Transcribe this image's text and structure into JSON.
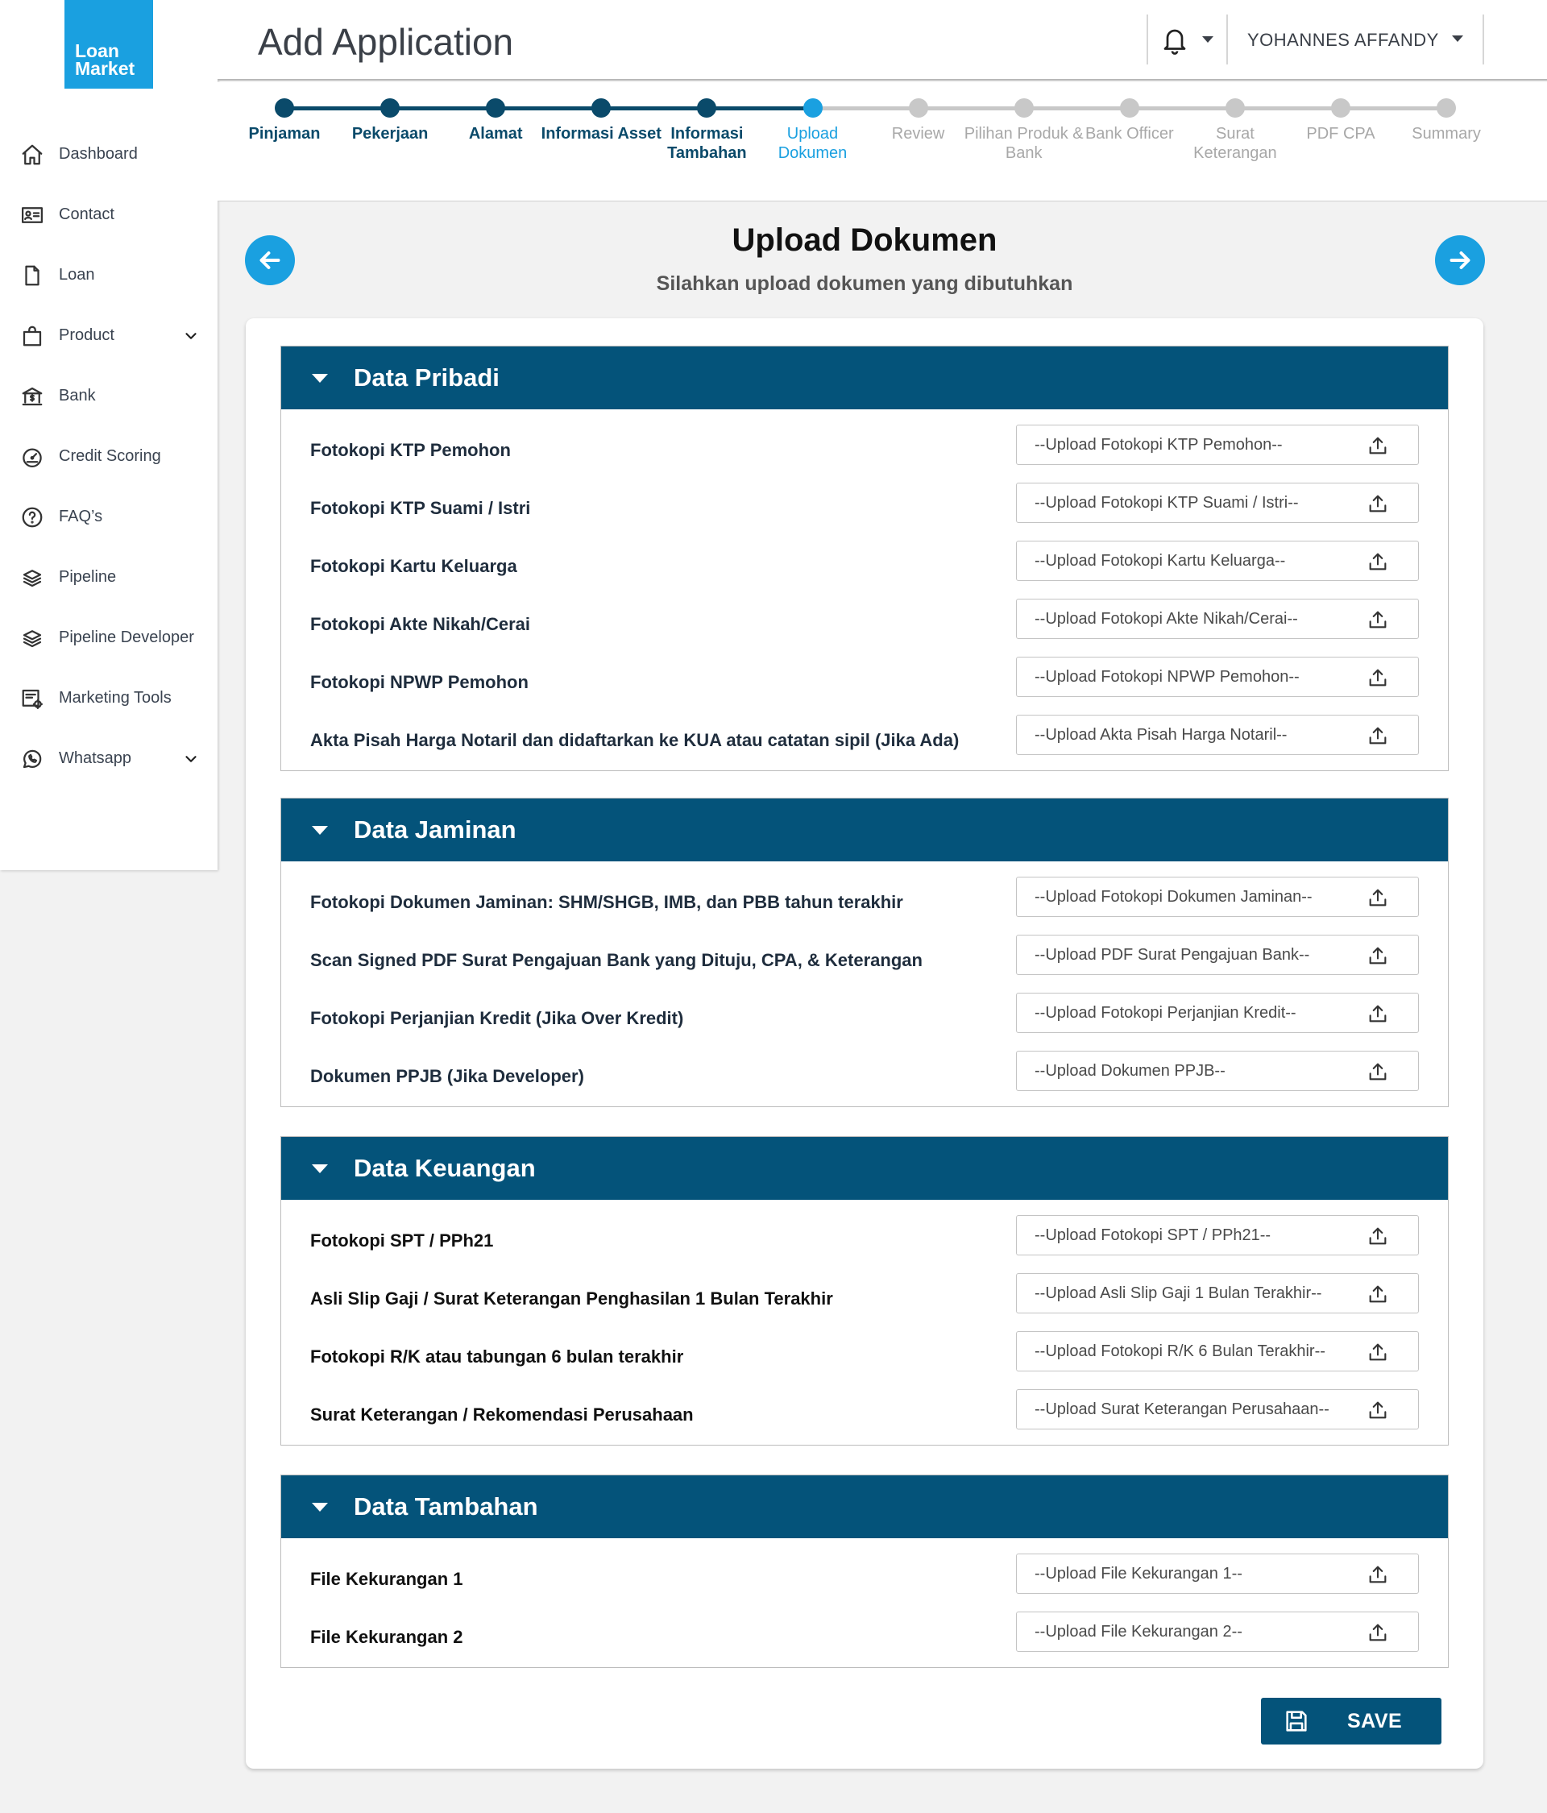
{
  "logo": {
    "line1": "Loan",
    "line2": "Market"
  },
  "sidebar": {
    "items": [
      {
        "label": "Dashboard",
        "icon": "home-icon"
      },
      {
        "label": "Contact",
        "icon": "contact-card-icon"
      },
      {
        "label": "Loan",
        "icon": "document-icon"
      },
      {
        "label": "Product",
        "icon": "shopping-bag-icon",
        "expandable": true
      },
      {
        "label": "Bank",
        "icon": "bank-icon"
      },
      {
        "label": "Credit Scoring",
        "icon": "gauge-icon"
      },
      {
        "label": "FAQ’s",
        "icon": "question-circle-icon"
      },
      {
        "label": "Pipeline",
        "icon": "layers-icon"
      },
      {
        "label": "Pipeline Developer",
        "icon": "layers-icon"
      },
      {
        "label": "Marketing Tools",
        "icon": "marketing-tools-icon"
      },
      {
        "label": "Whatsapp",
        "icon": "whatsapp-icon",
        "expandable": true
      }
    ]
  },
  "header": {
    "title": "Add Application",
    "user_name": "YOHANNES AFFANDY"
  },
  "stepper": {
    "steps": [
      {
        "label": "Pinjaman",
        "state": "done"
      },
      {
        "label": "Pekerjaan",
        "state": "done"
      },
      {
        "label": "Alamat",
        "state": "done"
      },
      {
        "label": "Informasi Asset",
        "state": "done"
      },
      {
        "label": "Informasi Tambahan",
        "state": "done"
      },
      {
        "label": "Upload Dokumen",
        "state": "active"
      },
      {
        "label": "Review",
        "state": "pending"
      },
      {
        "label": "Pilihan Produk & Bank",
        "state": "pending"
      },
      {
        "label": "Bank Officer",
        "state": "pending"
      },
      {
        "label": "Surat Keterangan",
        "state": "pending"
      },
      {
        "label": "PDF CPA",
        "state": "pending"
      },
      {
        "label": "Summary",
        "state": "pending"
      }
    ]
  },
  "main": {
    "title": "Upload Dokumen",
    "subtitle": "Silahkan upload dokumen yang dibutuhkan",
    "groups": [
      {
        "title": "Data Pribadi",
        "rows": [
          {
            "label": "Fotokopi KTP Pemohon",
            "placeholder": "--Upload Fotokopi KTP Pemohon--"
          },
          {
            "label": "Fotokopi KTP Suami / Istri",
            "placeholder": "--Upload Fotokopi KTP Suami / Istri--"
          },
          {
            "label": "Fotokopi Kartu Keluarga",
            "placeholder": "--Upload Fotokopi Kartu Keluarga--"
          },
          {
            "label": "Fotokopi Akte Nikah/Cerai",
            "placeholder": "--Upload Fotokopi Akte Nikah/Cerai--"
          },
          {
            "label": "Fotokopi NPWP Pemohon",
            "placeholder": "--Upload Fotokopi NPWP Pemohon--"
          },
          {
            "label": "Akta Pisah Harga Notaril dan didaftarkan ke KUA atau catatan sipil (Jika Ada)",
            "placeholder": "--Upload Akta Pisah Harga Notaril--"
          }
        ]
      },
      {
        "title": "Data Jaminan",
        "rows": [
          {
            "label": "Fotokopi Dokumen Jaminan: SHM/SHGB, IMB, dan PBB tahun terakhir",
            "placeholder": "--Upload Fotokopi Dokumen Jaminan--"
          },
          {
            "label": "Scan Signed PDF Surat Pengajuan Bank yang Dituju, CPA, & Keterangan",
            "placeholder": "--Upload PDF Surat Pengajuan Bank--"
          },
          {
            "label": "Fotokopi Perjanjian Kredit (Jika Over Kredit)",
            "placeholder": "--Upload Fotokopi Perjanjian Kredit--"
          },
          {
            "label": "Dokumen PPJB (Jika Developer)",
            "placeholder": "--Upload Dokumen PPJB--"
          }
        ]
      },
      {
        "title": "Data Keuangan",
        "rows": [
          {
            "label": "Fotokopi SPT / PPh21",
            "placeholder": "--Upload Fotokopi SPT / PPh21--"
          },
          {
            "label": "Asli Slip Gaji / Surat Keterangan Penghasilan 1 Bulan Terakhir",
            "placeholder": "--Upload Asli Slip Gaji 1 Bulan Terakhir--"
          },
          {
            "label": "Fotokopi R/K atau tabungan 6 bulan terakhir",
            "placeholder": "--Upload Fotokopi R/K 6 Bulan Terakhir--"
          },
          {
            "label": "Surat Keterangan / Rekomendasi Perusahaan",
            "placeholder": "--Upload Surat Keterangan Perusahaan--"
          }
        ]
      },
      {
        "title": "Data Tambahan",
        "rows": [
          {
            "label": "File Kekurangan 1",
            "placeholder": "--Upload File Kekurangan 1--"
          },
          {
            "label": "File Kekurangan 2",
            "placeholder": "--Upload File Kekurangan 2--"
          }
        ]
      }
    ],
    "save_label": "SAVE"
  },
  "colors": {
    "primary": "#04537a",
    "accent": "#1aa0e0",
    "step_done": "#0a4a6a",
    "step_pending": "#c8c8c8",
    "step_pending_text": "#a8a8a8"
  }
}
